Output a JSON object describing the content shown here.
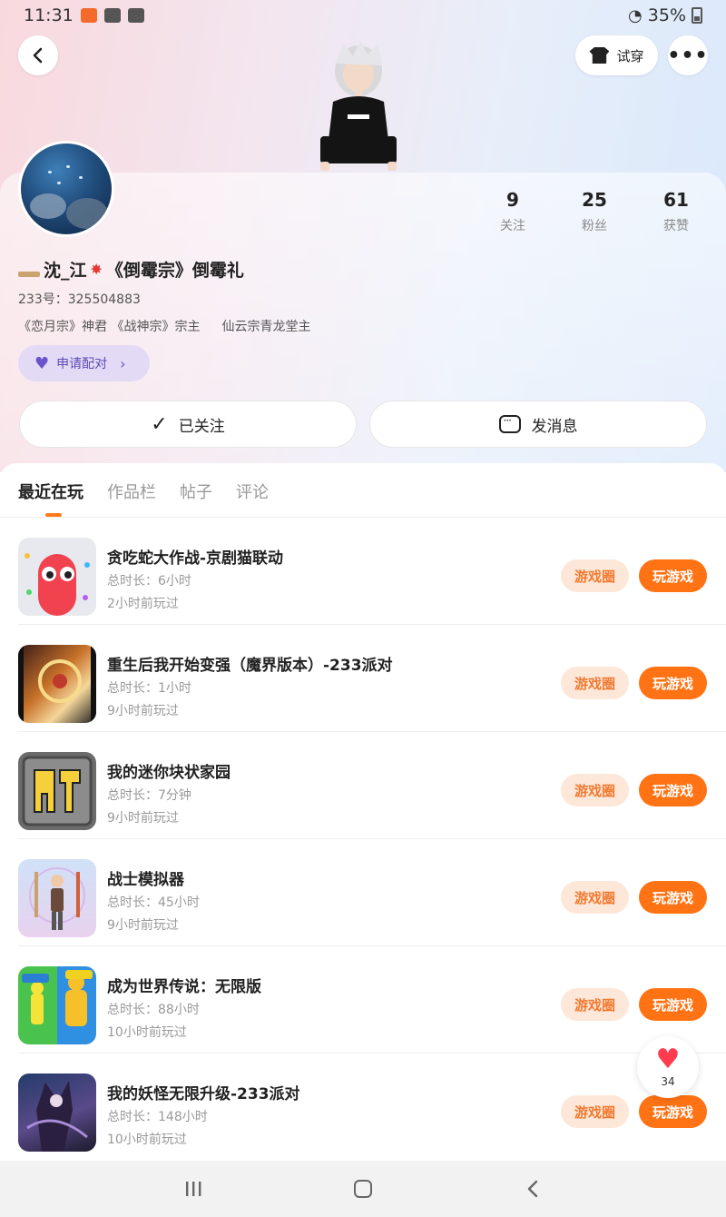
{
  "status_bar": {
    "time": "11:31",
    "battery": "35%"
  },
  "header": {
    "try_on_label": "试穿"
  },
  "profile": {
    "stats": [
      {
        "value": "9",
        "label": "关注"
      },
      {
        "value": "25",
        "label": "粉丝"
      },
      {
        "value": "61",
        "label": "获赞"
      }
    ],
    "username": "沈_江",
    "username_suffix": "《倒霉宗》倒霉礼",
    "user_id": "233号：325504883",
    "titles": [
      "《恋月宗》神君 《战神宗》宗主",
      "仙云宗青龙堂主"
    ],
    "pair_label": "申请配对",
    "follow_label": "已关注",
    "message_label": "发消息"
  },
  "tabs": [
    "最近在玩",
    "作品栏",
    "帖子",
    "评论"
  ],
  "games": [
    {
      "title": "贪吃蛇大作战-京剧猫联动",
      "duration": "总时长：6小时",
      "last_played": "2小时前玩过"
    },
    {
      "title": "重生后我开始变强（魔界版本）-233派对",
      "duration": "总时长：1小时",
      "last_played": "9小时前玩过"
    },
    {
      "title": "我的迷你块状家园",
      "duration": "总时长：7分钟",
      "last_played": "9小时前玩过"
    },
    {
      "title": "战士模拟器",
      "duration": "总时长：45小时",
      "last_played": "9小时前玩过"
    },
    {
      "title": "成为世界传说：无限版",
      "duration": "总时长：88小时",
      "last_played": "10小时前玩过"
    },
    {
      "title": "我的妖怪无限升级-233派对",
      "duration": "总时长：148小时",
      "last_played": "10小时前玩过"
    }
  ],
  "game_actions": {
    "circle_label": "游戏圈",
    "play_label": "玩游戏"
  },
  "like_widget": {
    "count": "34"
  },
  "colors": {
    "accent_orange": "#ff7314",
    "pill_bg": "#fde7d8",
    "pair_purple": "#e3daf6"
  }
}
